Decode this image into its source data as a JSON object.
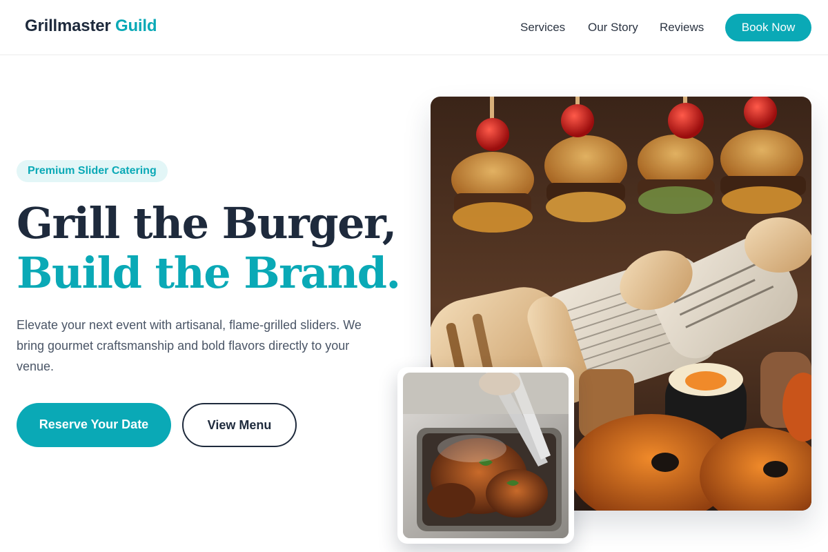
{
  "brand": {
    "name": "Grillmaster",
    "accent": "Guild"
  },
  "nav": {
    "links": [
      "Services",
      "Our Story",
      "Reviews"
    ],
    "cta": "Book Now"
  },
  "hero": {
    "badge": "Premium Slider Catering",
    "headline_line1": "Grill the Burger,",
    "headline_line2": "Build the Brand.",
    "description": "Elevate your next event with artisanal, flame-grilled sliders. We bring gourmet craftsmanship and bold flavors directly to your venue.",
    "primary_button": "Reserve Your Date",
    "secondary_button": "View Menu"
  },
  "images": {
    "main": "sliders-and-wraps-photo",
    "inset": "grilled-meat-tongs-photo"
  },
  "colors": {
    "accent": "#0aa9b6",
    "dark": "#1e2a3c",
    "badge_bg": "#e3f6f7"
  }
}
